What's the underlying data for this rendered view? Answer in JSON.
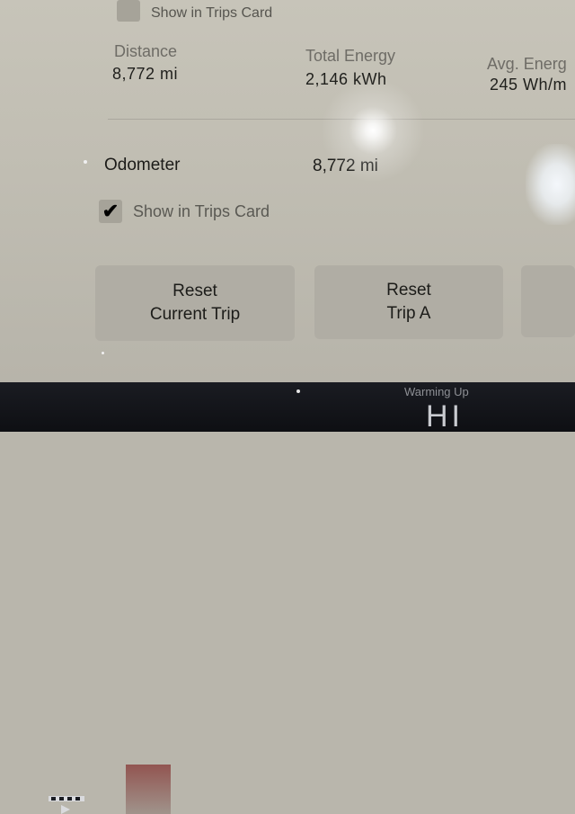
{
  "top_checkbox": {
    "label": "Show in Trips Card"
  },
  "stats": [
    {
      "label": "Distance",
      "value": "8,772 mi"
    },
    {
      "label": "Total Energy",
      "value": "2,146 kWh"
    },
    {
      "label": "Avg. Energ",
      "value": "245 Wh/m"
    }
  ],
  "odometer": {
    "label": "Odometer",
    "value": "8,772 mi"
  },
  "show_trips": {
    "label": "Show in Trips Card",
    "checked": true,
    "check_glyph": "✔"
  },
  "buttons": {
    "reset_current": {
      "line1": "Reset",
      "line2": "Current Trip"
    },
    "reset_trip_a": {
      "line1": "Reset",
      "line2": "Trip A"
    }
  },
  "status_bar": {
    "warming_text": "Warming Up",
    "fan_level": "HI"
  }
}
